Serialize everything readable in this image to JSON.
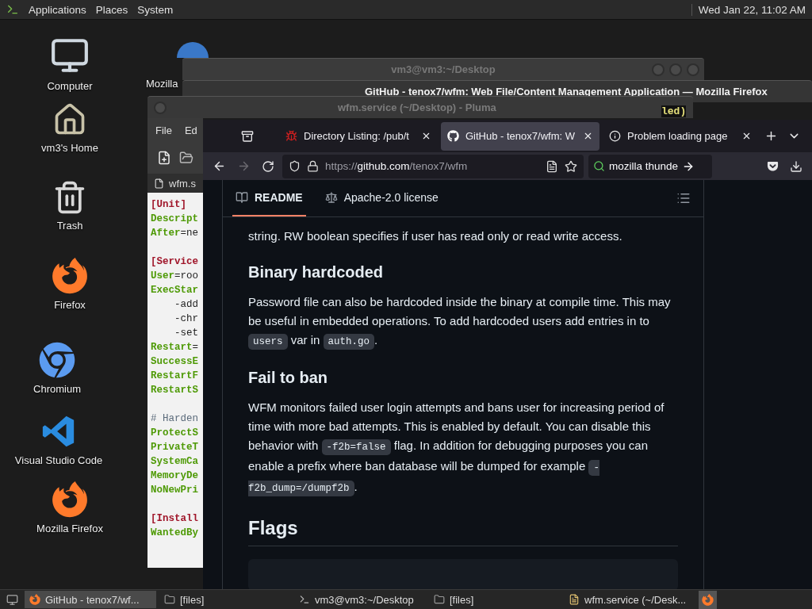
{
  "top_panel": {
    "menus": [
      "Applications",
      "Places",
      "System"
    ],
    "clock": "Wed Jan 22, 11:02 AM"
  },
  "desktop_icons": [
    {
      "label": "Computer",
      "kind": "computer"
    },
    {
      "label": "vm3's Home",
      "kind": "home"
    },
    {
      "label": "Trash",
      "kind": "trash"
    },
    {
      "label": "Firefox",
      "kind": "firefox"
    },
    {
      "label": "Chromium",
      "kind": "chromium"
    },
    {
      "label": "Visual Studio Code",
      "kind": "vscode"
    },
    {
      "label": "Mozilla Firefox",
      "kind": "firefox"
    }
  ],
  "hidden_icon_label": "Mozilla",
  "terminal_window": {
    "title": "vm3@vm3:~/Desktop",
    "fragment": "led)"
  },
  "firefox_window": {
    "title": "GitHub - tenox7/wfm: Web File/Content Management Application — Mozilla Firefox",
    "tabs": [
      {
        "label": "Directory Listing: /pub/t",
        "selected": false,
        "kind": "bug"
      },
      {
        "label": "GitHub - tenox7/wfm: W",
        "selected": true,
        "kind": "github"
      },
      {
        "label": "Problem loading page",
        "selected": false,
        "kind": "info"
      }
    ],
    "forward_disabled": true,
    "url": {
      "scheme": "https://",
      "host": "github.com",
      "path": "/tenox7/wfm"
    },
    "search": "mozilla thunde"
  },
  "pluma_window": {
    "title": "wfm.service (~/Desktop) - Pluma",
    "menus": [
      "File",
      "Ed"
    ],
    "tab": "wfm.s",
    "lines": [
      {
        "kind": "section",
        "text": "[Unit]"
      },
      {
        "kind": "key",
        "key": "Descript"
      },
      {
        "kind": "key",
        "key": "After",
        "value": "=ne"
      },
      {
        "kind": "blank"
      },
      {
        "kind": "section",
        "text": "[Service"
      },
      {
        "kind": "key",
        "key": "User",
        "value": "=roo"
      },
      {
        "kind": "key",
        "key": "ExecStar"
      },
      {
        "kind": "plain",
        "text": "    -add"
      },
      {
        "kind": "plain",
        "text": "    -chr"
      },
      {
        "kind": "plain",
        "text": "    -set"
      },
      {
        "kind": "key",
        "key": "Restart",
        "value": "="
      },
      {
        "kind": "key",
        "key": "SuccessE"
      },
      {
        "kind": "key",
        "key": "RestartF"
      },
      {
        "kind": "key",
        "key": "RestartS"
      },
      {
        "kind": "blank"
      },
      {
        "kind": "comment",
        "text": "# Harden"
      },
      {
        "kind": "key",
        "key": "ProtectS"
      },
      {
        "kind": "key",
        "key": "PrivateT"
      },
      {
        "kind": "key",
        "key": "SystemCa"
      },
      {
        "kind": "key",
        "key": "MemoryDe"
      },
      {
        "kind": "key",
        "key": "NoNewPri"
      },
      {
        "kind": "blank"
      },
      {
        "kind": "section",
        "text": "[Install"
      },
      {
        "kind": "key",
        "key": "WantedBy"
      }
    ]
  },
  "readme": {
    "tabs": [
      {
        "label": "README",
        "selected": true,
        "kind": "book"
      },
      {
        "label": "Apache-2.0 license",
        "selected": false,
        "kind": "scale"
      }
    ],
    "blocks": [
      {
        "kind": "paragraph",
        "segments": [
          {
            "kind": "text",
            "text": "string. RW boolean specifies if user has read only or read write access."
          }
        ]
      },
      {
        "kind": "heading",
        "text": "Binary hardcoded"
      },
      {
        "kind": "paragraph",
        "segments": [
          {
            "kind": "text",
            "text": "Password file can also be hardcoded inside the binary at compile time. This may be useful in embedded operations. To add hardcoded users add entries in to "
          },
          {
            "kind": "code",
            "text": "users"
          },
          {
            "kind": "text",
            "text": " var in "
          },
          {
            "kind": "code",
            "text": "auth.go"
          },
          {
            "kind": "text",
            "text": "."
          }
        ]
      },
      {
        "kind": "heading",
        "text": "Fail to ban"
      },
      {
        "kind": "paragraph",
        "segments": [
          {
            "kind": "text",
            "text": "WFM monitors failed user login attempts and bans user for increasing period of time with more bad attempts. This is enabled by default. You can disable this behavior with "
          },
          {
            "kind": "code",
            "text": "-f2b=false"
          },
          {
            "kind": "text",
            "text": " flag. In addition for debugging purposes you can enable a prefix where ban database will be dumped for example "
          },
          {
            "kind": "code",
            "text": "-f2b_dump=/dumpf2b"
          },
          {
            "kind": "text",
            "text": "."
          }
        ]
      },
      {
        "kind": "major_heading",
        "text": "Flags"
      },
      {
        "kind": "code_block"
      }
    ]
  },
  "taskbar": [
    {
      "label": "GitHub - tenox7/wf...",
      "kind": "firefox",
      "selected": true
    },
    {
      "label": "[files]",
      "kind": "folder",
      "selected": false
    },
    {
      "label": "vm3@vm3:~/Desktop",
      "kind": "terminal",
      "selected": false
    },
    {
      "label": "[files]",
      "kind": "folder",
      "selected": false
    },
    {
      "label": "wfm.service (~/Desk...",
      "kind": "editor",
      "selected": false
    }
  ]
}
